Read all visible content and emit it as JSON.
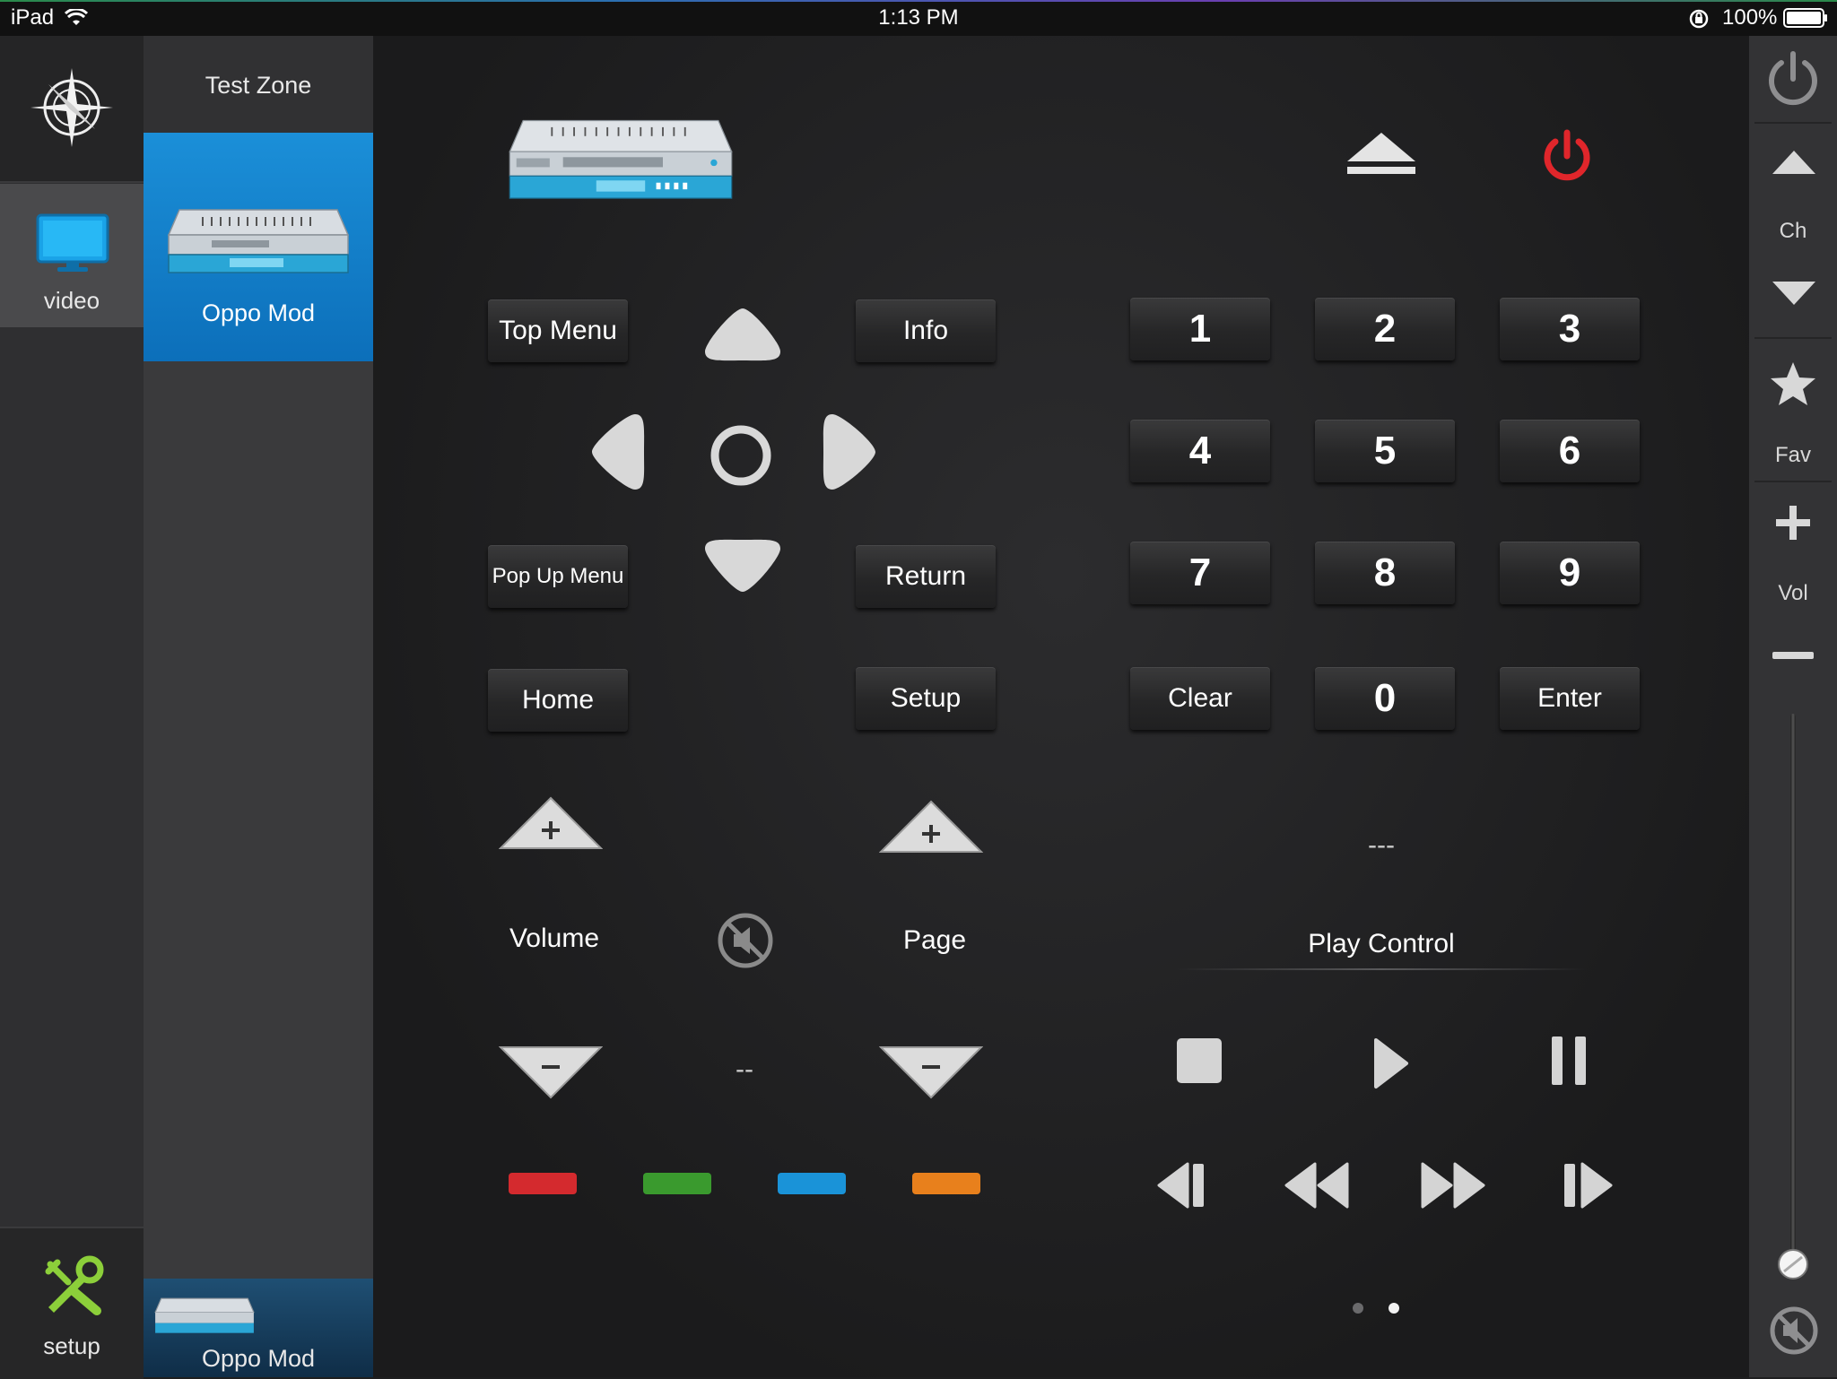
{
  "status_bar": {
    "device": "iPad",
    "time": "1:13 PM",
    "battery": "100%"
  },
  "nav": {
    "logo": "compass-logo",
    "items": [
      {
        "label": "video",
        "icon": "monitor-icon",
        "selected": true
      },
      {
        "label": "setup",
        "icon": "tools-icon",
        "selected": false
      }
    ]
  },
  "zone": {
    "title": "Test Zone",
    "active_device": "Oppo Mod",
    "bottom_device": "Oppo Mod"
  },
  "remote": {
    "buttons": {
      "top_menu": "Top Menu",
      "info": "Info",
      "pop_up_menu": "Pop Up Menu",
      "return": "Return",
      "home": "Home",
      "setup": "Setup"
    },
    "keypad": [
      "1",
      "2",
      "3",
      "4",
      "5",
      "6",
      "7",
      "8",
      "9",
      "Clear",
      "0",
      "Enter"
    ],
    "volume_label": "Volume",
    "page_label": "Page",
    "volume_value": "--",
    "keypad_display": "---",
    "play_control_label": "Play Control",
    "color_buttons": [
      "#d42a2e",
      "#3a9a2e",
      "#1a93d8",
      "#e8801c"
    ]
  },
  "rail": {
    "ch_label": "Ch",
    "fav_label": "Fav",
    "vol_label": "Vol",
    "volume_level": 0.0
  },
  "pager": {
    "pages": 2,
    "current": 2
  },
  "colors": {
    "accent": "#1b8fd8",
    "power": "#e0262b"
  }
}
